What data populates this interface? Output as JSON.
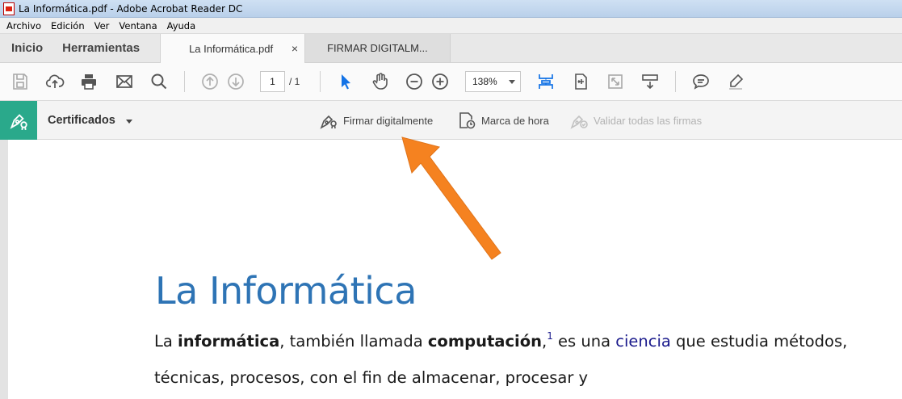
{
  "window": {
    "title": "La Informática.pdf - Adobe Acrobat Reader DC"
  },
  "menu": [
    "Archivo",
    "Edición",
    "Ver",
    "Ventana",
    "Ayuda"
  ],
  "nav": {
    "home": "Inicio",
    "tools": "Herramientas"
  },
  "tabs": [
    {
      "label": "La Informática.pdf",
      "active": true,
      "close": "×"
    },
    {
      "label": "FIRMAR DIGITALM...",
      "active": false
    }
  ],
  "toolbar": {
    "page_current": "1",
    "page_total": "/ 1",
    "zoom": "138%"
  },
  "certificates": {
    "label": "Certificados",
    "actions": [
      {
        "label": "Firmar digitalmente",
        "enabled": true,
        "icon": "pen-sign-icon"
      },
      {
        "label": "Marca de hora",
        "enabled": true,
        "icon": "timestamp-icon"
      },
      {
        "label": "Validar todas las firmas",
        "enabled": false,
        "icon": "validate-signatures-icon"
      }
    ]
  },
  "document": {
    "heading": "La Informática",
    "line1": {
      "t1": "La ",
      "b1": "informática",
      "t2": ", también llamada ",
      "b2": "computación",
      "t3": ",",
      "footnote": "1",
      "t4": " es una ",
      "link": "ciencia",
      "t5": " que estudia métodos,"
    },
    "line2": "técnicas, procesos, con el fin de almacenar, procesar y"
  },
  "colors": {
    "accent_teal": "#2aa98b",
    "heading_blue": "#2e74b5",
    "annotation_arrow": "#f58220",
    "tool_blue": "#1473e6"
  }
}
